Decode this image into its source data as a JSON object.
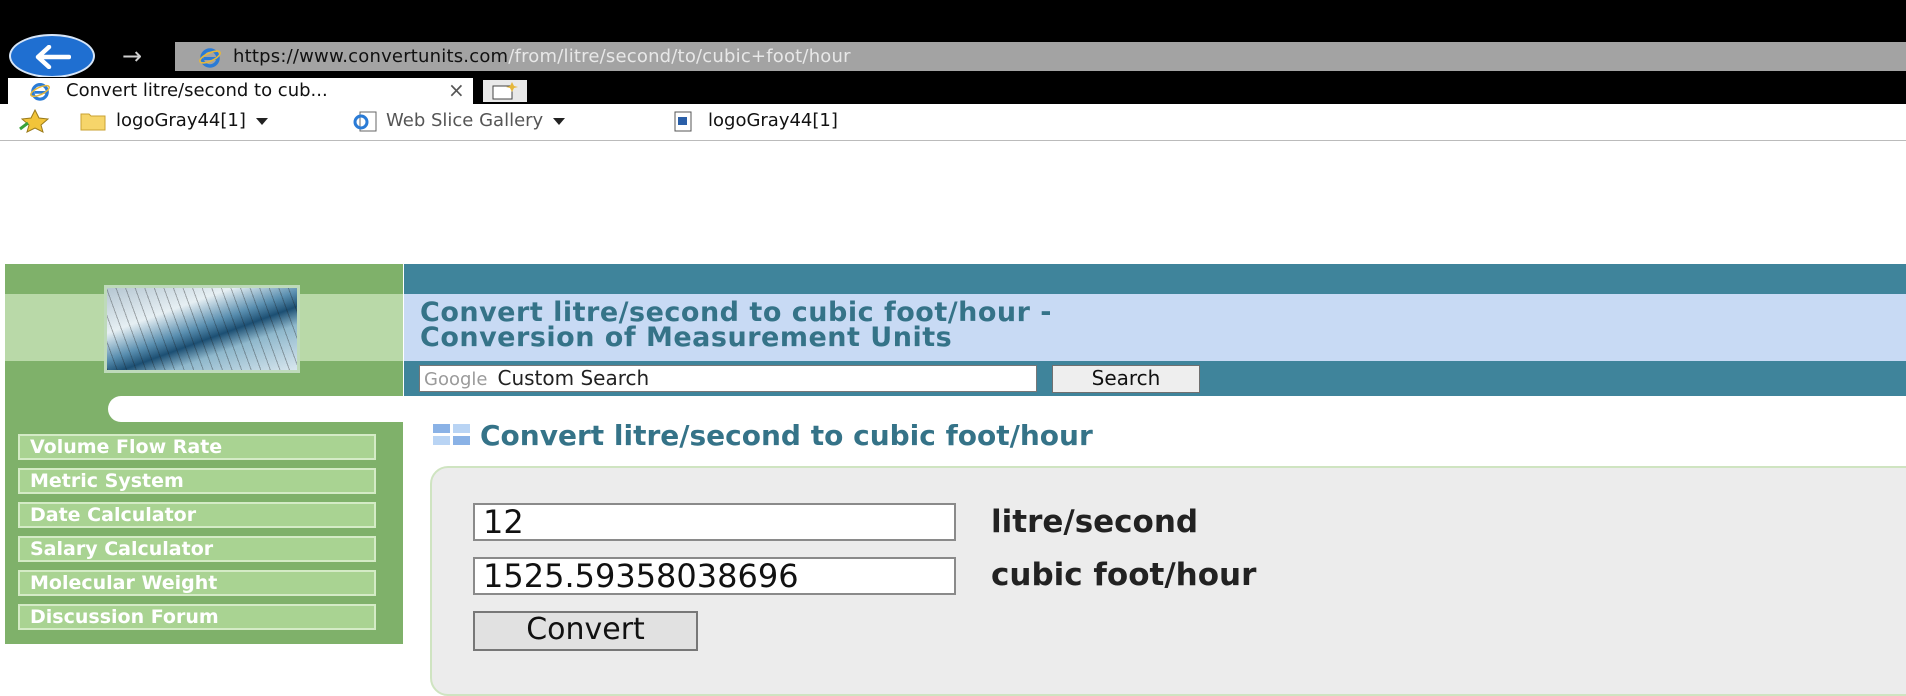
{
  "browser": {
    "url_prefix": "https://www.",
    "url_domain": "convertunits.com",
    "url_path": "/from/litre/second/to/cubic+foot/hour",
    "tab_title": "Convert litre/second to cub...",
    "tab_close": "×",
    "favorites": [
      {
        "label": "logoGray44[1]"
      },
      {
        "label": "Web Slice Gallery"
      },
      {
        "label": "logoGray44[1]"
      }
    ]
  },
  "header": {
    "title_line1": "Convert litre/second to cubic foot/hour -",
    "title_line2": "Conversion of Measurement Units"
  },
  "search": {
    "google_label": "Google",
    "placeholder": "Custom Search",
    "button": "Search"
  },
  "sidebar": {
    "items": [
      {
        "label": "Volume Flow Rate"
      },
      {
        "label": "Metric System"
      },
      {
        "label": "Date Calculator"
      },
      {
        "label": "Salary Calculator"
      },
      {
        "label": "Molecular Weight"
      },
      {
        "label": "Discussion Forum"
      }
    ]
  },
  "main": {
    "heading": "Convert litre/second to cubic foot/hour",
    "from_value": "12",
    "from_unit": "litre/second",
    "to_value": "1525.59358038696",
    "to_unit": "cubic foot/hour",
    "convert_button": "Convert"
  },
  "colors": {
    "teal": "#3f849b",
    "header_blue": "#c8daf4",
    "sidebar_green": "#7fb16a",
    "link_green": "#a9d392"
  }
}
